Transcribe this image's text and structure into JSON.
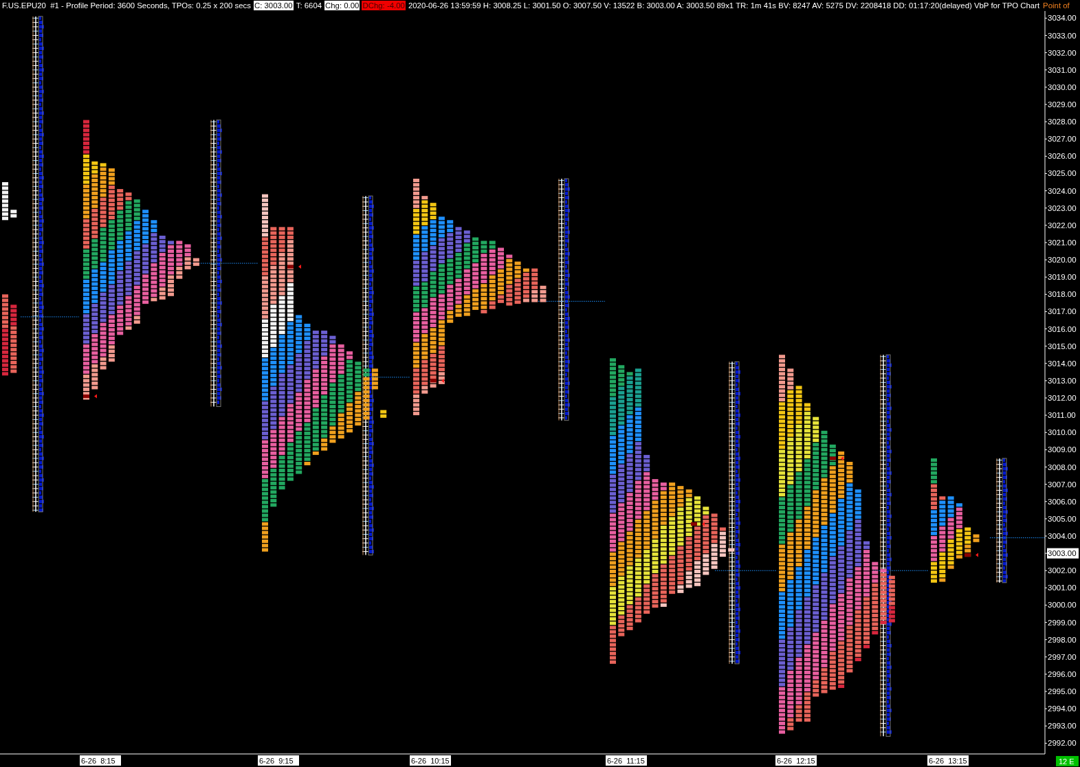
{
  "header": {
    "segments": [
      {
        "text": "F.US.EPU20  #1 - Profile Period: 3600 Seconds, TPOs: 0.25 x 200 secs",
        "kind": "plain"
      },
      {
        "text": "C: 3003.00",
        "kind": "highlight"
      },
      {
        "text": "T: 6604",
        "kind": "plain"
      },
      {
        "text": "Chg: 0.00",
        "kind": "highlight"
      },
      {
        "text": "DChg: -4.00",
        "kind": "alert"
      },
      {
        "text": "2020-06-26 13:59:59 H: 3008.25 L: 3001.50 O: 3007.50 V: 13522 B: 3003.00 A: 3003.50 89x1 TR: 1m 41s BV: 8247 AV: 5275 DV: 2208418 DD: 01:17:20(delayed) VbP for TPO Chart",
        "kind": "plain"
      },
      {
        "text": "Point of",
        "kind": "accent"
      }
    ]
  },
  "price_axis": {
    "labels": [
      {
        "text": "3034.00",
        "current": false
      },
      {
        "text": "3033.00",
        "current": false
      },
      {
        "text": "3032.00",
        "current": false
      },
      {
        "text": "3031.00",
        "current": false
      },
      {
        "text": "3030.00",
        "current": false
      },
      {
        "text": "3029.00",
        "current": false
      },
      {
        "text": "3028.00",
        "current": false
      },
      {
        "text": "3027.00",
        "current": false
      },
      {
        "text": "3026.00",
        "current": false
      },
      {
        "text": "3025.00",
        "current": false
      },
      {
        "text": "3024.00",
        "current": false
      },
      {
        "text": "3023.00",
        "current": false
      },
      {
        "text": "3022.00",
        "current": false
      },
      {
        "text": "3021.00",
        "current": false
      },
      {
        "text": "3020.00",
        "current": false
      },
      {
        "text": "3019.00",
        "current": false
      },
      {
        "text": "3018.00",
        "current": false
      },
      {
        "text": "3017.00",
        "current": false
      },
      {
        "text": "3016.00",
        "current": false
      },
      {
        "text": "3015.00",
        "current": false
      },
      {
        "text": "3014.00",
        "current": false
      },
      {
        "text": "3013.00",
        "current": false
      },
      {
        "text": "3012.00",
        "current": false
      },
      {
        "text": "3011.00",
        "current": false
      },
      {
        "text": "3010.00",
        "current": false
      },
      {
        "text": "3009.00",
        "current": false
      },
      {
        "text": "3008.00",
        "current": false
      },
      {
        "text": "3007.00",
        "current": false
      },
      {
        "text": "3006.00",
        "current": false
      },
      {
        "text": "3005.00",
        "current": false
      },
      {
        "text": "3004.00",
        "current": false
      },
      {
        "text": "3003.00",
        "current": true
      },
      {
        "text": "3002.00",
        "current": false
      },
      {
        "text": "3001.00",
        "current": false
      },
      {
        "text": "3000.00",
        "current": false
      },
      {
        "text": "2999.00",
        "current": false
      },
      {
        "text": "2998.00",
        "current": false
      },
      {
        "text": "2997.00",
        "current": false
      },
      {
        "text": "2996.00",
        "current": false
      },
      {
        "text": "2995.00",
        "current": false
      },
      {
        "text": "2994.00",
        "current": false
      },
      {
        "text": "2993.00",
        "current": false
      },
      {
        "text": "2992.00",
        "current": false
      }
    ]
  },
  "time_axis": {
    "labels": [
      "6-26  8:15",
      "6-26  9:15",
      "6-26  10:15",
      "6-26  11:15",
      "6-26  12:15",
      "6-26  13:15"
    ]
  },
  "status_badge": {
    "text": "12 E"
  }
}
